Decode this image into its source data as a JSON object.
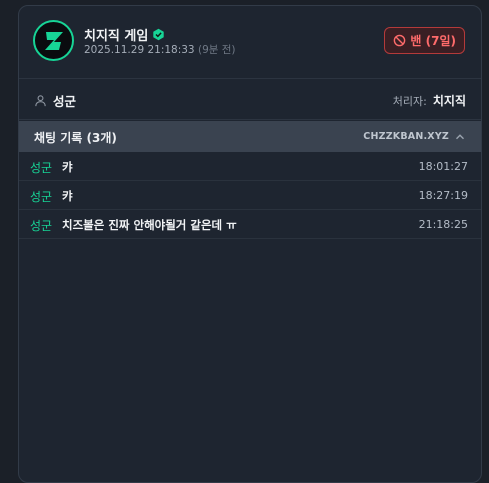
{
  "header": {
    "channel_name": "치지직 게임",
    "datetime": "2025.11.29 21:18:33",
    "relative_time": "(9분 전)",
    "ban_badge": "밴 (7일)",
    "avatar_icon": "chzzk-logo-icon",
    "verified_icon": "verified-badge-icon"
  },
  "user_row": {
    "user_name": "성군",
    "handler_label": "처리자:",
    "handler_name": "치지직"
  },
  "chat": {
    "title": "채팅 기록 (3개)",
    "source": "CHZZKBAN.XYZ",
    "messages": [
      {
        "user": "성군",
        "text": "캬",
        "time": "18:01:27"
      },
      {
        "user": "성군",
        "text": "캬",
        "time": "18:27:19"
      },
      {
        "user": "성군",
        "text": "치즈볼은 진짜 안해야될거 같은데 ㅠ",
        "time": "21:18:25"
      }
    ]
  },
  "colors": {
    "accent": "#17d496",
    "ban": "#ff6b6b",
    "background": "#1b2028",
    "card": "#1e2530"
  }
}
